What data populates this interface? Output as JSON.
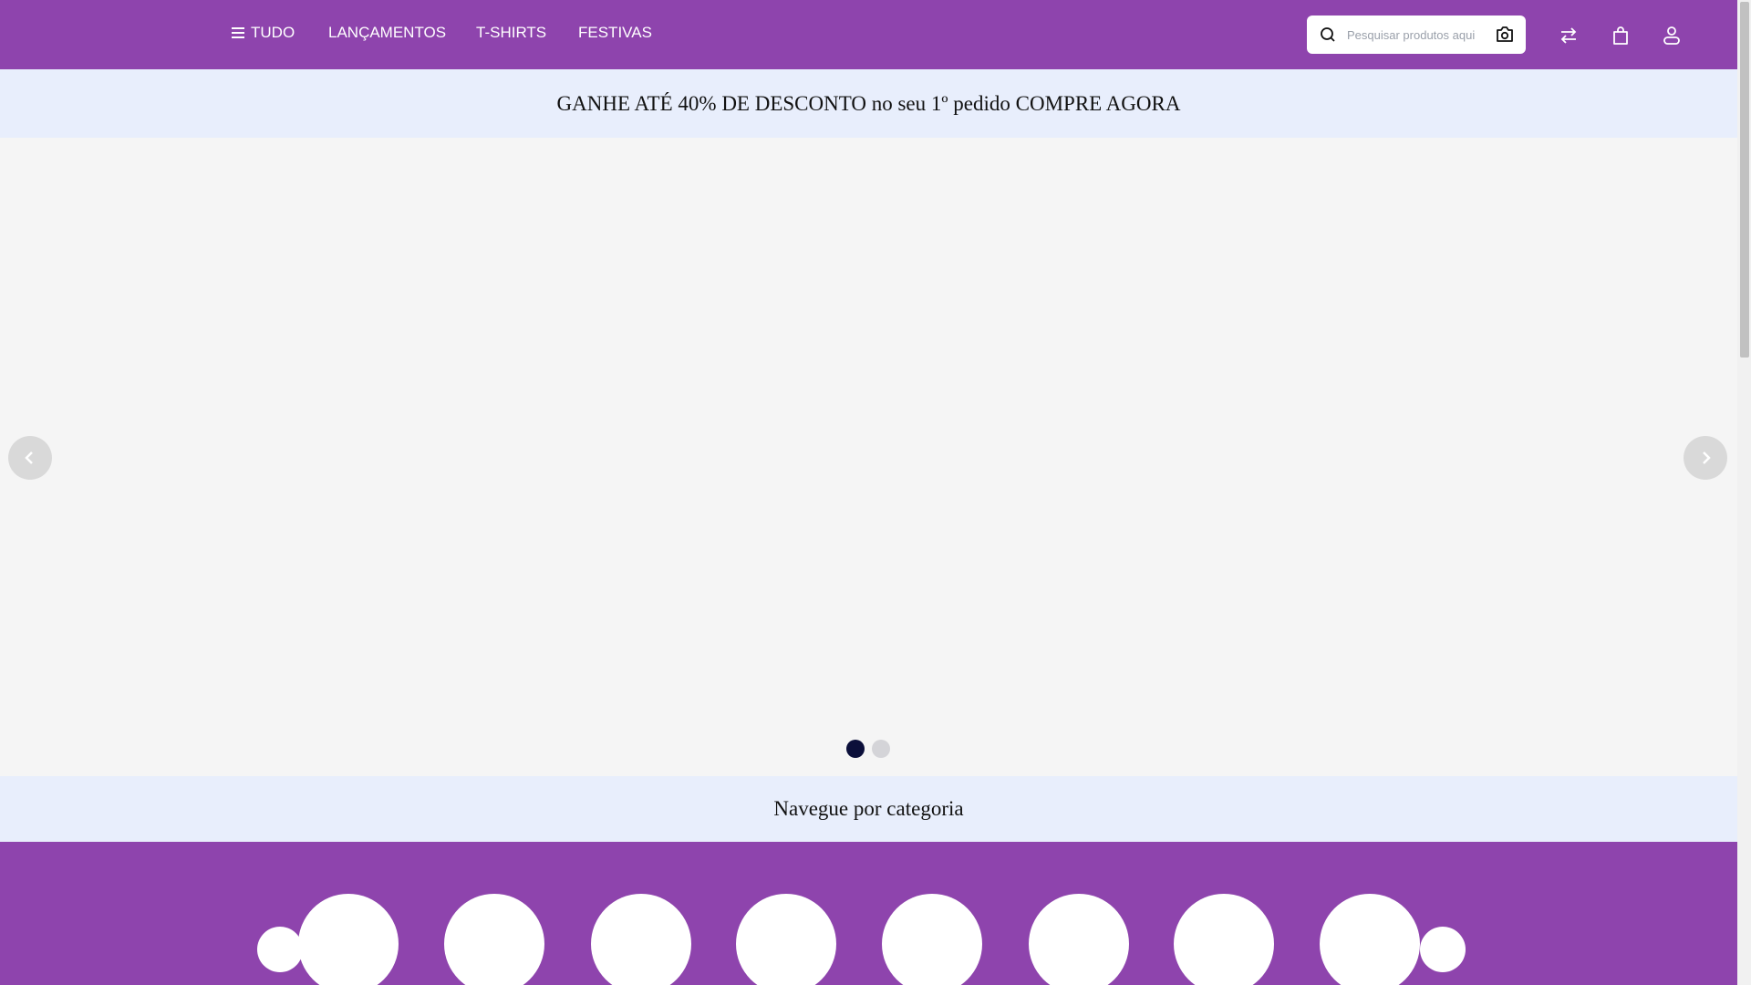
{
  "header": {
    "nav": [
      {
        "label": "TUDO",
        "icon": "menu-icon"
      },
      {
        "label": "LANÇAMENTOS"
      },
      {
        "label": "T-SHIRTS"
      },
      {
        "label": "FESTIVAS"
      }
    ],
    "search": {
      "placeholder": "Pesquisar produtos aqui"
    },
    "icons": [
      "compare-icon",
      "shopping-bag-icon",
      "user-icon"
    ]
  },
  "promo": {
    "text": "GANHE ATÉ 40% DE DESCONTO no seu 1º pedido COMPRE AGORA"
  },
  "slider": {
    "slide_count": 2,
    "active_slide": 1
  },
  "categories": {
    "title": "Navegue por categoria",
    "item_count": 8
  },
  "colors": {
    "brand": "#8e44ad",
    "promo_bg": "#e8eefc",
    "dot_active": "#0b0f3a"
  }
}
